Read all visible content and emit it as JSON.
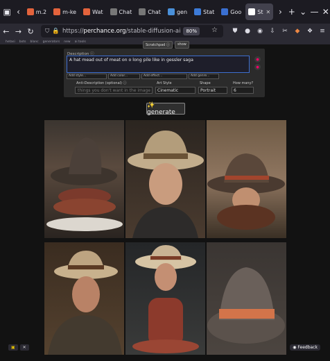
{
  "tabs": [
    {
      "label": "m.2",
      "color": "#e3633c"
    },
    {
      "label": "m-ke",
      "color": "#e3633c"
    },
    {
      "label": "Wat",
      "color": "#e3633c"
    },
    {
      "label": "Chat",
      "color": "#777777"
    },
    {
      "label": "Chat",
      "color": "#777777"
    },
    {
      "label": "gen",
      "color": "#4a90d9"
    },
    {
      "label": "Stat",
      "color": "#3d7bd8"
    },
    {
      "label": "Goo",
      "color": "#3a6fd1"
    },
    {
      "label": "St",
      "color": "#ffffff",
      "active": true
    }
  ],
  "url": {
    "prefix": "https://",
    "host": "perchance.org",
    "path": "/stable-diffusion-ai",
    "zoom": "80%"
  },
  "bookmarks": [
    "hetasi",
    "bots",
    "blanc",
    "generators",
    "new",
    "ai tools"
  ],
  "scratchpad": {
    "label": "Scratchpad ⓘ",
    "show": "show"
  },
  "description": {
    "label": "Description ⓘ",
    "value": "A hat mead out of meat on o long pile like in gessler saga"
  },
  "selects": [
    "Add style...",
    "Add color...",
    "Add effect...",
    "Add genre..."
  ],
  "anti": {
    "label": "Anti-Description (optional) ⓘ",
    "placeholder": "things you don't want in the image"
  },
  "art_style": {
    "label": "Art Style",
    "value": "Cinematic"
  },
  "shape": {
    "label": "Shape",
    "value": "Portrait"
  },
  "how_many": {
    "label": "How many?",
    "value": "6"
  },
  "generate_label": "✨ generate",
  "feedback_label": "Feedback"
}
